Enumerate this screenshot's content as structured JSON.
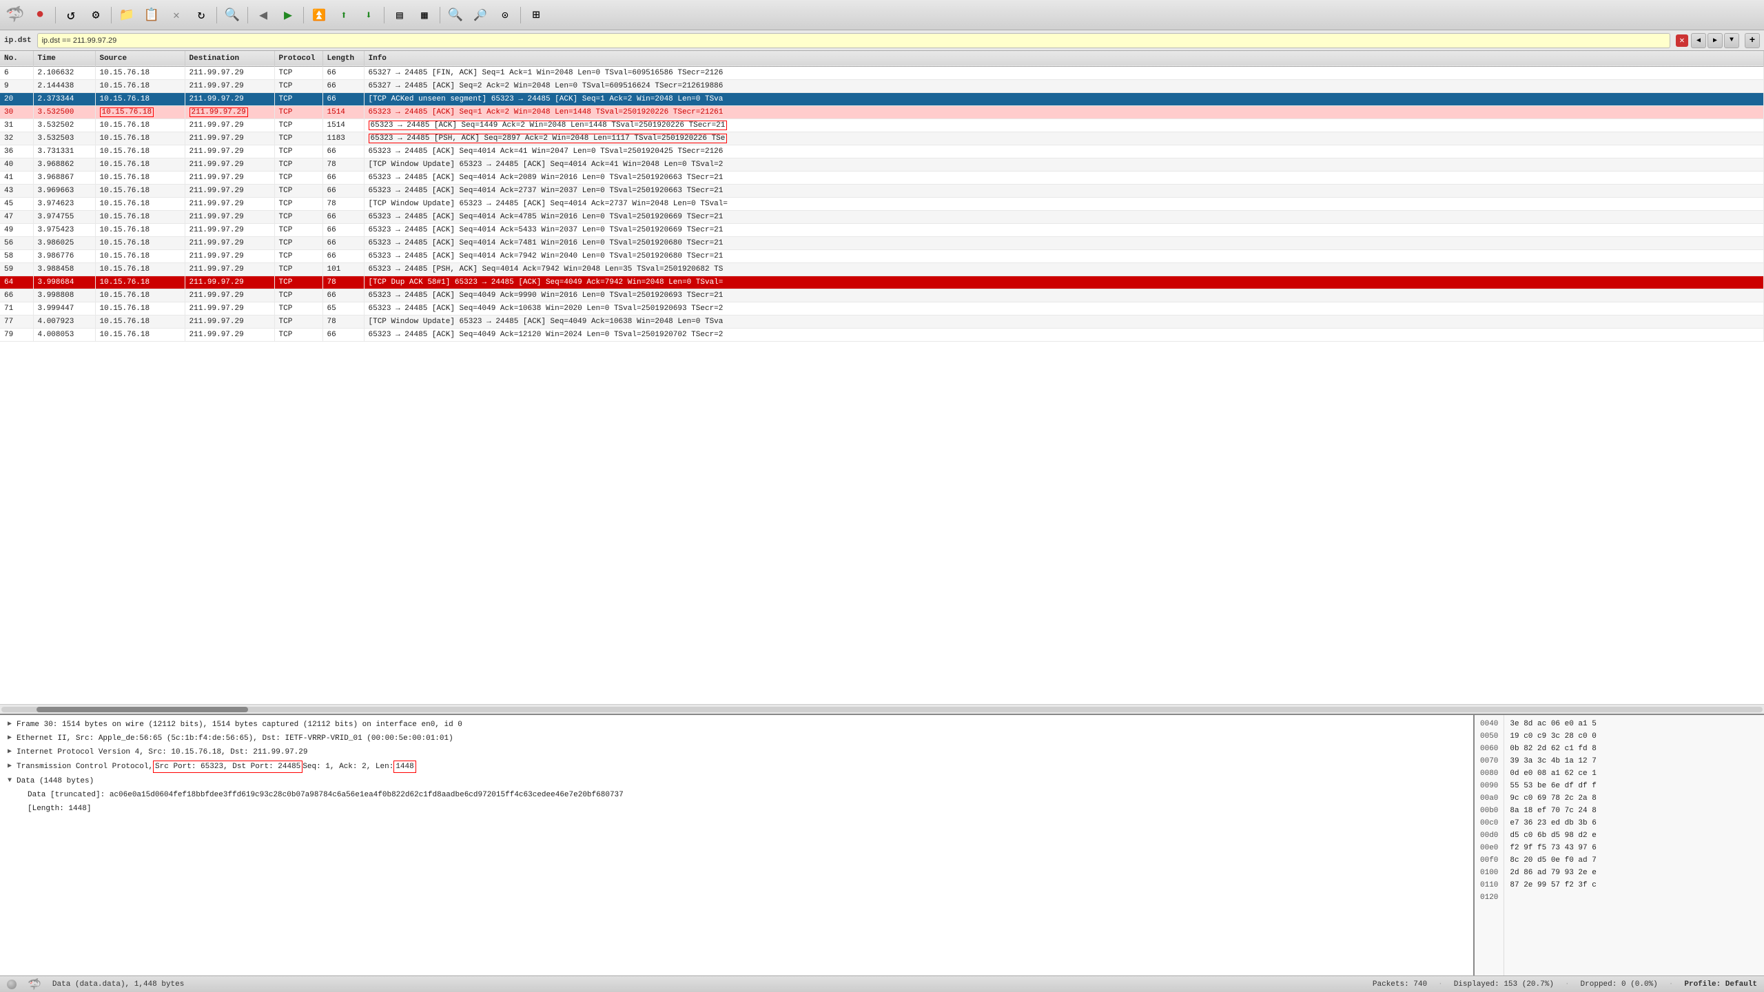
{
  "toolbar": {
    "icons": [
      {
        "name": "logo",
        "symbol": "🦈"
      },
      {
        "name": "close-red",
        "symbol": "●",
        "color": "#cc3333"
      },
      {
        "name": "restart",
        "symbol": "↺"
      },
      {
        "name": "preferences",
        "symbol": "⚙"
      },
      {
        "name": "open-file",
        "symbol": "📁"
      },
      {
        "name": "open-capture",
        "symbol": "📋"
      },
      {
        "name": "close-capture",
        "symbol": "✕"
      },
      {
        "name": "reload",
        "symbol": "↻"
      },
      {
        "name": "find-packet",
        "symbol": "🔍"
      },
      {
        "name": "go-back",
        "symbol": "←"
      },
      {
        "name": "go-forward",
        "symbol": "→"
      },
      {
        "name": "go-first",
        "symbol": "⏮"
      },
      {
        "name": "go-up",
        "symbol": "↑"
      },
      {
        "name": "go-down",
        "symbol": "↓"
      },
      {
        "name": "colorize",
        "symbol": "▤"
      },
      {
        "name": "coloring-rules",
        "symbol": "▦"
      },
      {
        "name": "zoom-in",
        "symbol": "🔍"
      },
      {
        "name": "zoom-out",
        "symbol": "🔎"
      },
      {
        "name": "zoom-reset",
        "symbol": "⊙"
      },
      {
        "name": "resize-columns",
        "symbol": "⊞"
      }
    ]
  },
  "filter": {
    "label": "ip.dst",
    "value": "ip.dst == 211.99.97.29"
  },
  "columns": {
    "no": "No.",
    "time": "Time",
    "source": "Source",
    "destination": "Destination",
    "protocol": "Protocol",
    "length": "Length",
    "info": "Info"
  },
  "packets": [
    {
      "no": "6",
      "time": "2.106632",
      "src": "10.15.76.18",
      "dst": "211.99.97.29",
      "proto": "TCP",
      "len": "66",
      "info": "65327 → 24485 [FIN, ACK] Seq=1 Ack=1 Win=2048 Len=0 TSval=609516586 TSecr=2126",
      "style": "normal"
    },
    {
      "no": "9",
      "time": "2.144438",
      "src": "10.15.76.18",
      "dst": "211.99.97.29",
      "proto": "TCP",
      "len": "66",
      "info": "65327 → 24485 [ACK] Seq=2 Ack=2 Win=2048 Len=0 TSval=609516624 TSecr=212619886",
      "style": "normal"
    },
    {
      "no": "20",
      "time": "2.373344",
      "src": "10.15.76.18",
      "dst": "211.99.97.29",
      "proto": "TCP",
      "len": "66",
      "info": "[TCP ACKed unseen segment] 65323 → 24485 [ACK] Seq=1 Ack=2 Win=2048 Len=0 TSva",
      "style": "selected-dark"
    },
    {
      "no": "30",
      "time": "3.532500",
      "src": "10.15.76.18",
      "dst": "211.99.97.29",
      "proto": "TCP",
      "len": "1514",
      "info": "65323 → 24485  [ACK] Seq=1 Ack=2 Win=2048 Len=1448 TSval=2501920226 TSecr=21261",
      "style": "row-red",
      "src_box": true,
      "dst_box": true
    },
    {
      "no": "31",
      "time": "3.532502",
      "src": "10.15.76.18",
      "dst": "211.99.97.29",
      "proto": "TCP",
      "len": "1514",
      "info": "65323 → 24485  [ACK] Seq=1449 Ack=2 Win=2048 Len=1448 TSval=2501920226 TSecr=21",
      "style": "normal",
      "info_box": true
    },
    {
      "no": "32",
      "time": "3.532503",
      "src": "10.15.76.18",
      "dst": "211.99.97.29",
      "proto": "TCP",
      "len": "1183",
      "info": "65323 → 24485  [PSH, ACK] Seq=2897 Ack=2 Win=2048 Len=1117 TSval=2501920226 TSe",
      "style": "normal",
      "info_box": true
    },
    {
      "no": "36",
      "time": "3.731331",
      "src": "10.15.76.18",
      "dst": "211.99.97.29",
      "proto": "TCP",
      "len": "66",
      "info": "65323 → 24485 [ACK] Seq=4014 Ack=41 Win=2047 Len=0 TSval=2501920425 TSecr=2126",
      "style": "normal"
    },
    {
      "no": "40",
      "time": "3.968862",
      "src": "10.15.76.18",
      "dst": "211.99.97.29",
      "proto": "TCP",
      "len": "78",
      "info": "[TCP Window Update] 65323 → 24485 [ACK] Seq=4014 Ack=41 Win=2048 Len=0 TSval=2",
      "style": "normal"
    },
    {
      "no": "41",
      "time": "3.968867",
      "src": "10.15.76.18",
      "dst": "211.99.97.29",
      "proto": "TCP",
      "len": "66",
      "info": "65323 → 24485 [ACK] Seq=4014 Ack=2089 Win=2016 Len=0 TSval=2501920663 TSecr=21",
      "style": "normal"
    },
    {
      "no": "43",
      "time": "3.969663",
      "src": "10.15.76.18",
      "dst": "211.99.97.29",
      "proto": "TCP",
      "len": "66",
      "info": "65323 → 24485 [ACK] Seq=4014 Ack=2737 Win=2037 Len=0 TSval=2501920663 TSecr=21",
      "style": "normal"
    },
    {
      "no": "45",
      "time": "3.974623",
      "src": "10.15.76.18",
      "dst": "211.99.97.29",
      "proto": "TCP",
      "len": "78",
      "info": "[TCP Window Update] 65323 → 24485 [ACK] Seq=4014 Ack=2737 Win=2048 Len=0 TSval=",
      "style": "normal"
    },
    {
      "no": "47",
      "time": "3.974755",
      "src": "10.15.76.18",
      "dst": "211.99.97.29",
      "proto": "TCP",
      "len": "66",
      "info": "65323 → 24485 [ACK] Seq=4014 Ack=4785 Win=2016 Len=0 TSval=2501920669 TSecr=21",
      "style": "normal"
    },
    {
      "no": "49",
      "time": "3.975423",
      "src": "10.15.76.18",
      "dst": "211.99.97.29",
      "proto": "TCP",
      "len": "66",
      "info": "65323 → 24485 [ACK] Seq=4014 Ack=5433 Win=2037 Len=0 TSval=2501920669 TSecr=21",
      "style": "normal"
    },
    {
      "no": "56",
      "time": "3.986025",
      "src": "10.15.76.18",
      "dst": "211.99.97.29",
      "proto": "TCP",
      "len": "66",
      "info": "65323 → 24485 [ACK] Seq=4014 Ack=7481 Win=2016 Len=0 TSval=2501920680 TSecr=21",
      "style": "normal"
    },
    {
      "no": "58",
      "time": "3.986776",
      "src": "10.15.76.18",
      "dst": "211.99.97.29",
      "proto": "TCP",
      "len": "66",
      "info": "65323 → 24485 [ACK] Seq=4014 Ack=7942 Win=2040 Len=0 TSval=2501920680 TSecr=21",
      "style": "normal"
    },
    {
      "no": "59",
      "time": "3.988458",
      "src": "10.15.76.18",
      "dst": "211.99.97.29",
      "proto": "TCP",
      "len": "101",
      "info": "65323 → 24485 [PSH, ACK] Seq=4014 Ack=7942 Win=2048 Len=35 TSval=2501920682 TS",
      "style": "normal"
    },
    {
      "no": "64",
      "time": "3.998684",
      "src": "10.15.76.18",
      "dst": "211.99.97.29",
      "proto": "TCP",
      "len": "78",
      "info": "[TCP Dup ACK 58#1] 65323 → 24485 [ACK] Seq=4049 Ack=7942 Win=2048 Len=0 TSval=",
      "style": "row-selected-red"
    },
    {
      "no": "66",
      "time": "3.998808",
      "src": "10.15.76.18",
      "dst": "211.99.97.29",
      "proto": "TCP",
      "len": "66",
      "info": "65323 → 24485 [ACK] Seq=4049 Ack=9990 Win=2016 Len=0 TSval=2501920693 TSecr=21",
      "style": "normal"
    },
    {
      "no": "71",
      "time": "3.999447",
      "src": "10.15.76.18",
      "dst": "211.99.97.29",
      "proto": "TCP",
      "len": "65",
      "info": "65323 → 24485 [ACK] Seq=4049 Ack=10638 Win=2020 Len=0 TSval=2501920693 TSecr=2",
      "style": "normal"
    },
    {
      "no": "77",
      "time": "4.007923",
      "src": "10.15.76.18",
      "dst": "211.99.97.29",
      "proto": "TCP",
      "len": "78",
      "info": "[TCP Window Update] 65323 → 24485 [ACK] Seq=4049 Ack=10638 Win=2048 Len=0 TSva",
      "style": "normal"
    },
    {
      "no": "79",
      "time": "4.008053",
      "src": "10.15.76.18",
      "dst": "211.99.97.29",
      "proto": "TCP",
      "len": "66",
      "info": "65323 → 24485 [ACK] Seq=4049 Ack=12120 Win=2024 Len=0 TSval=2501920702 TSecr=2",
      "style": "normal"
    }
  ],
  "details": [
    {
      "text": "Frame 30: 1514 bytes on wire (12112 bits), 1514 bytes captured (12112 bits) on interface en0, id 0",
      "level": 0,
      "expandable": true,
      "expanded": false
    },
    {
      "text": "Ethernet II, Src: Apple_de:56:65 (5c:1b:f4:de:56:65), Dst: IETF-VRRP-VRID_01 (00:00:5e:00:01:01)",
      "level": 0,
      "expandable": true,
      "expanded": false
    },
    {
      "text": "Internet Protocol Version 4, Src: 10.15.76.18, Dst: 211.99.97.29",
      "level": 0,
      "expandable": true,
      "expanded": false
    },
    {
      "text": "Transmission Control Protocol, Src Port: 65323, Dst Port: 24485  Seq: 1, Ack: 2, Len: 1448",
      "level": 0,
      "expandable": true,
      "expanded": false,
      "has_highlights": true
    },
    {
      "text": "Data (1448 bytes)",
      "level": 0,
      "expandable": true,
      "expanded": true
    },
    {
      "text": "Data [truncated]: ac06e0a15d0604fef18bbfdee3ffd619c93c28c0b07a98784c6a56e1ea4f0b822d62c1fd8aadbe6cd972015ff4c63cedee46e7e20bf680737",
      "level": 1,
      "expandable": false
    },
    {
      "text": "[Length: 1448]",
      "level": 1,
      "expandable": false
    }
  ],
  "hex": {
    "offsets": [
      "0040",
      "0050",
      "0060",
      "0070",
      "0080",
      "0090",
      "00a0",
      "00b0",
      "00c0",
      "00d0",
      "00e0",
      "00f0",
      "0100",
      "0110",
      "0120"
    ],
    "bytes": [
      "3e 8d ac 06 e0 a1 5",
      "19 c0 c9 3c 28 c0 0",
      "0b 82 2d 62 c1 fd 8",
      "39 3a 3c 4b 1a 12 7",
      "0d e0 08 a1 62 ce 1",
      "55 53 be 6e df df f",
      "9c c0 69 78 2c 2a 8",
      "8a 18 ef 70 7c 24 8",
      "e7 36 23 ed db 3b 6",
      "d5 c0 6b d5 98 d2 e",
      "f2 9f f5 73 43 97 6",
      "8c 20 d5 0e f0 ad 7",
      "2d 86 ad 79 93 2e e",
      "87 2e 99 57 f2 3f c"
    ]
  },
  "status": {
    "file_info": "Data (data.data), 1,448 bytes",
    "packets": "Packets: 740",
    "displayed": "Displayed: 153 (20.7%)",
    "dropped": "Dropped: 0 (0.0%)",
    "profile": "Profile: Default"
  }
}
